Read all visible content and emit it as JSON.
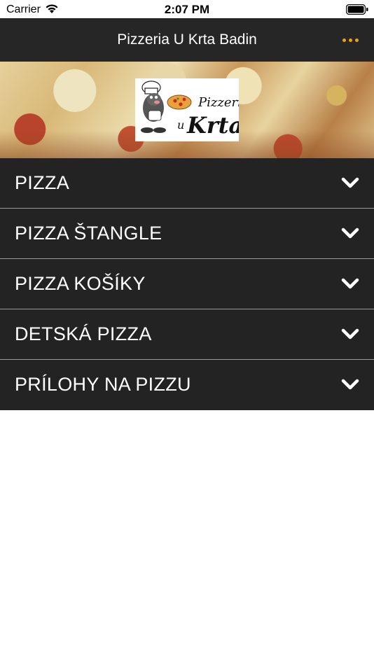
{
  "status_bar": {
    "carrier": "Carrier",
    "time": "2:07 PM"
  },
  "nav": {
    "title": "Pizzeria U Krta Badin",
    "more_icon": "more-horizontal-icon",
    "accent_color": "#f5a300"
  },
  "logo": {
    "text_top": "Pizzeria",
    "text_u": "u",
    "text_main": "Krta"
  },
  "menu": {
    "items": [
      {
        "label": "PIZZA"
      },
      {
        "label": "PIZZA ŠTANGLE"
      },
      {
        "label": "PIZZA KOŠÍKY"
      },
      {
        "label": "DETSKÁ PIZZA"
      },
      {
        "label": "PRÍLOHY NA PIZZU"
      }
    ]
  },
  "colors": {
    "nav_bg": "#262626",
    "row_bg": "#232323",
    "divider": "#9a9a9a"
  }
}
